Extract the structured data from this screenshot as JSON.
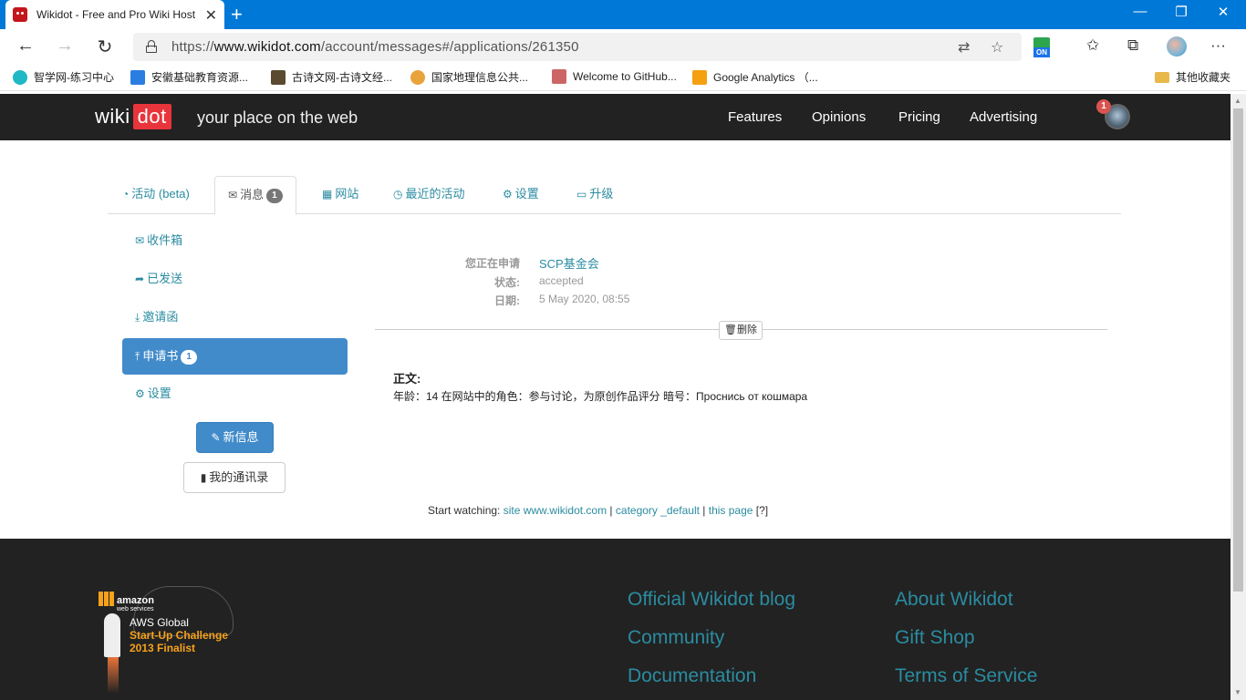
{
  "browser": {
    "tab_title": "Wikidot - Free and Pro Wiki Host",
    "url_prefix": "https://",
    "url_host": "www.wikidot.com",
    "url_path": "/account/messages#/applications/261350",
    "ext_label": "ON",
    "bookmarks": [
      {
        "label": "智学网-练习中心",
        "color": "#1fb8c4"
      },
      {
        "label": "安徽基础教育资源...",
        "color": "#2a7de1"
      },
      {
        "label": "古诗文网-古诗文经...",
        "color": "#5a4a2f"
      },
      {
        "label": "国家地理信息公共...",
        "color": "#e8a33b"
      },
      {
        "label": "Welcome to GitHub...",
        "color": "#c66"
      },
      {
        "label": "Google Analytics （...",
        "color": "#f4a010"
      }
    ],
    "other_bookmarks": "其他收藏夹"
  },
  "header": {
    "logo_wiki": "wiki",
    "logo_dot": "dot",
    "tagline": "your place on the web",
    "nav": [
      "Features",
      "Opinions",
      "Pricing",
      "Advertising"
    ],
    "notification_count": "1"
  },
  "tabs": [
    {
      "label": "活动 (beta)",
      "icon": "dashboard-icon"
    },
    {
      "label": "消息",
      "icon": "envelope-icon",
      "badge": "1",
      "active": true
    },
    {
      "label": "网站",
      "icon": "grid-icon"
    },
    {
      "label": "最近的活动",
      "icon": "clock-icon"
    },
    {
      "label": "设置",
      "icon": "gears-icon"
    },
    {
      "label": "升级",
      "icon": "credit-card-icon"
    }
  ],
  "sidebar": {
    "items": [
      {
        "label": "收件箱",
        "icon": "envelope-icon"
      },
      {
        "label": "已发送",
        "icon": "share-icon"
      },
      {
        "label": "邀请函",
        "icon": "download-icon"
      },
      {
        "label": "申请书",
        "icon": "upload-icon",
        "badge": "1",
        "active": true
      },
      {
        "label": "设置",
        "icon": "gears-icon"
      }
    ],
    "new_message": "新信息",
    "address_book": "我的通讯录"
  },
  "application": {
    "applying_label": "您正在申请",
    "applying_value": "SCP基金会",
    "status_label": "状态:",
    "status_value": "accepted",
    "date_label": "日期:",
    "date_value": "5 May 2020, 08:55",
    "delete_label": "删除",
    "body_label": "正文:",
    "body_text": "年龄：14 在网站中的角色：参与讨论，为原创作品评分 暗号：Проснись от кошмара"
  },
  "watch": {
    "prefix": "Start watching:",
    "site": "site www.wikidot.com",
    "category": "category _default",
    "page": "this page",
    "help": "[?]"
  },
  "footer": {
    "links_col1": [
      "Official Wikidot blog",
      "Community",
      "Documentation"
    ],
    "links_col2": [
      "About Wikidot",
      "Gift Shop",
      "Terms of Service"
    ],
    "aws": {
      "brand": "amazon",
      "sub": "web services",
      "line1": "AWS Global",
      "line2": "Start-Up Challenge",
      "line3": "2013 Finalist"
    }
  }
}
